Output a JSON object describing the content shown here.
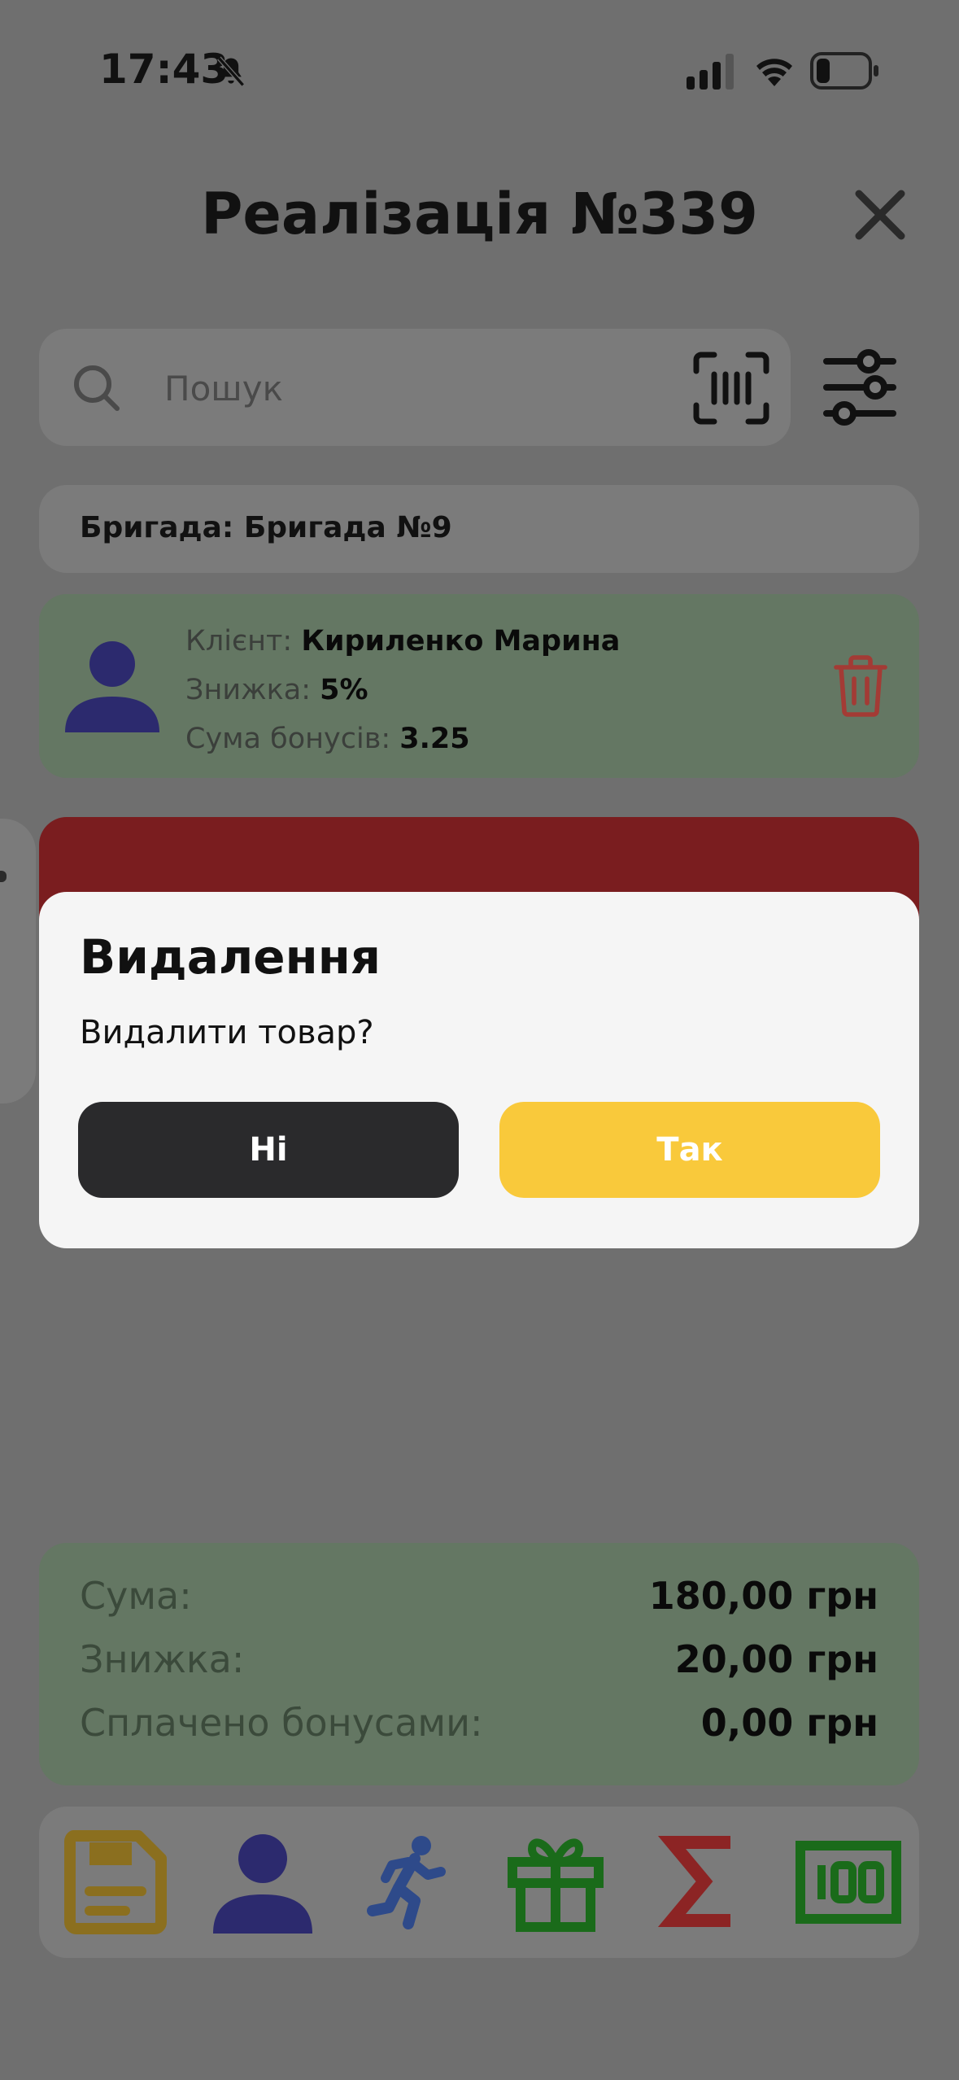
{
  "status_bar": {
    "time": "17:43",
    "icons": [
      "bell-slash-icon",
      "signal-icon",
      "wifi-icon",
      "battery-icon"
    ]
  },
  "header": {
    "title": "Реалізація №339",
    "close_icon": "close-icon"
  },
  "search": {
    "placeholder": "Пошук",
    "value": "",
    "icons": [
      "search-icon",
      "barcode-scan-icon",
      "filter-sliders-icon"
    ]
  },
  "brigade": {
    "text": "Бригада: Бригада №9"
  },
  "client": {
    "client_label": "Клієнт: ",
    "client_name": "Кириленко Марина",
    "discount_label": "Знижка: ",
    "discount_value": "5%",
    "bonus_label": "Сума бонусів: ",
    "bonus_value": "3.25"
  },
  "dialog": {
    "title": "Видалення",
    "message": "Видалити товар?",
    "no_label": "Ні",
    "yes_label": "Так"
  },
  "totals": {
    "sum_label": "Сума:",
    "sum_value": "180,00 грн",
    "discount_label": "Знижка:",
    "discount_value": "20,00 грн",
    "bonus_label": "Сплачено бонусами:",
    "bonus_value": "0,00 грн"
  },
  "toolbar": {
    "buttons": [
      "save-icon",
      "client-icon",
      "runner-icon",
      "gift-icon",
      "sigma-icon",
      "cash-icon"
    ]
  },
  "colors": {
    "overlay_bg": "#6f6f6f",
    "dialog_bg": "#f5f5f5",
    "no_button": "#2a2a2c",
    "yes_button": "#f9c93b",
    "client_card": "#647763",
    "delete_strip": "#7a1d1f",
    "save_icon": "#8b6f1f",
    "client_icon": "#2c2a6e",
    "runner_icon": "#2e4a8a",
    "gift_icon": "#1a6b1a",
    "sigma_icon": "#8c2424",
    "cash_icon": "#1a6b1a"
  }
}
